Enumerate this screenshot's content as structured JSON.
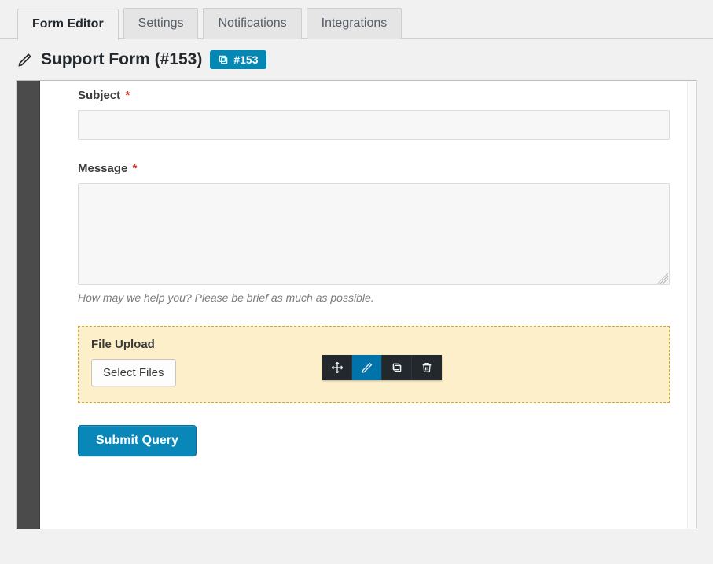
{
  "tabs": {
    "form_editor": "Form Editor",
    "settings": "Settings",
    "notifications": "Notifications",
    "integrations": "Integrations"
  },
  "header": {
    "title": "Support Form (#153)",
    "id_badge": "#153"
  },
  "fields": {
    "subject": {
      "label": "Subject",
      "required": "*",
      "value": ""
    },
    "message": {
      "label": "Message",
      "required": "*",
      "value": "",
      "hint": "How may we help you? Please be brief as much as possible."
    },
    "file_upload": {
      "label": "File Upload",
      "button": "Select Files"
    }
  },
  "field_toolbar": {
    "move": "move-icon",
    "edit": "pencil-icon",
    "duplicate": "copy-icon",
    "delete": "trash-icon"
  },
  "submit": {
    "label": "Submit Query"
  }
}
